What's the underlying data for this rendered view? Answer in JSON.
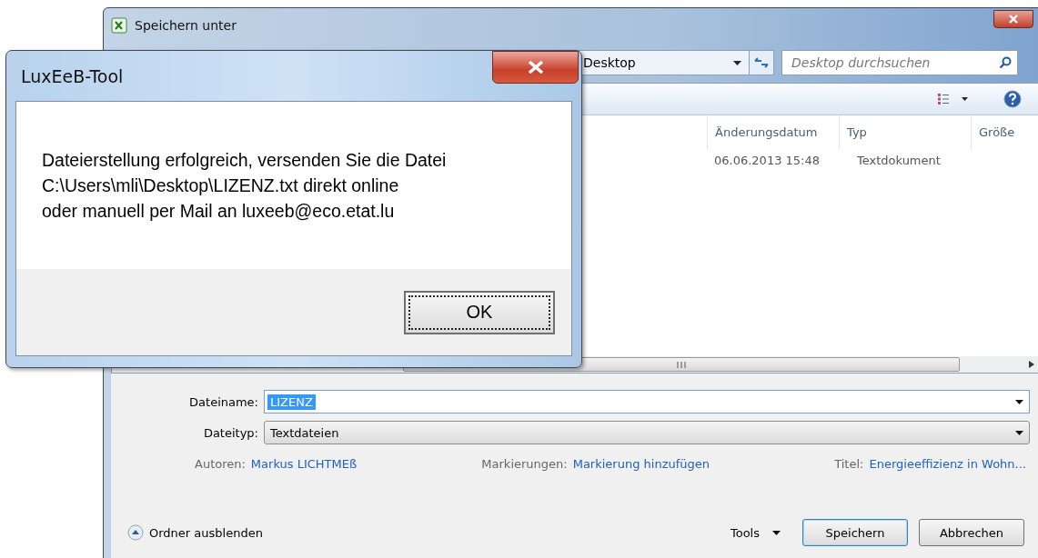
{
  "save_dialog": {
    "title": "Speichern unter",
    "address": {
      "location": "Desktop"
    },
    "search": {
      "placeholder": "Desktop durchsuchen"
    },
    "columns": [
      {
        "label": "Änderungsdatum"
      },
      {
        "label": "Typ"
      },
      {
        "label": "Größe"
      }
    ],
    "rows": [
      {
        "date": "06.06.2013 15:48",
        "type": "Textdokument"
      }
    ],
    "filename": {
      "label": "Dateiname:",
      "value": "LIZENZ",
      "text_selected": true
    },
    "filetype": {
      "label": "Dateityp:",
      "value": "Textdateien"
    },
    "metadata": [
      {
        "label": "Autoren:",
        "value": "Markus LICHTMEß"
      },
      {
        "label": "Markierungen:",
        "value": "Markierung hinzufügen"
      },
      {
        "label": "Titel:",
        "value": "Energieeffizienz in Wohn..."
      }
    ],
    "hide_folders": "Ordner ausblenden",
    "tools": "Tools",
    "buttons": [
      {
        "label": "Speichern",
        "default": true
      },
      {
        "label": "Abbrechen",
        "default": false
      }
    ]
  },
  "message_box": {
    "title": "LuxEeB-Tool",
    "message_lines": [
      "Dateierstellung erfolgreich, versenden Sie die Datei",
      "C:\\Users\\mli\\Desktop\\LIZENZ.txt direkt online",
      "oder manuell per Mail an luxeeb@eco.etat.lu"
    ],
    "button": "OK"
  }
}
